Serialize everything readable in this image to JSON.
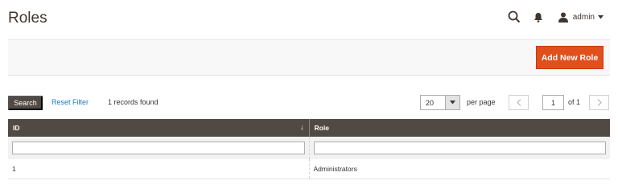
{
  "header": {
    "title": "Roles",
    "user_name": "admin",
    "icons": [
      "search-icon",
      "bell-icon",
      "user-icon",
      "caret-down-icon"
    ]
  },
  "actions": {
    "add_new_role_label": "Add New Role",
    "add_button_color": "#e04f1c"
  },
  "grid_controls": {
    "search_label": "Search",
    "reset_filter_label": "Reset Filter",
    "records_found": "1 records found",
    "per_page_value": "20",
    "per_page_label": "per page",
    "current_page": "1",
    "of_pages": "of 1"
  },
  "table": {
    "columns": [
      {
        "label": "ID",
        "sorted": "descending"
      },
      {
        "label": "Role"
      }
    ],
    "header_color": "#514943",
    "rows": [
      {
        "id": "1",
        "role": "Administrators"
      }
    ]
  }
}
